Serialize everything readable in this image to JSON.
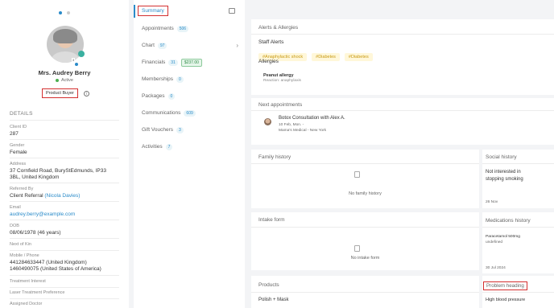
{
  "profile": {
    "name": "Mrs. Audrey Berry",
    "status": "Active",
    "tag": "Product Buyer",
    "avatar_badge": "3"
  },
  "details": {
    "heading": "DETAILS",
    "client_id_label": "Client ID",
    "client_id": "287",
    "gender_label": "Gender",
    "gender": "Female",
    "address_label": "Address",
    "address": "37 Cornfield Road, BuryStEdmunds, IP33 3BL, United Kingdom",
    "referred_label": "Referred By",
    "referred_prefix": "Client Referral",
    "referred_name": "(Nicola Davies)",
    "email_label": "Email",
    "email": "audrey.berry@example.com",
    "dob_label": "DOB",
    "dob": "08/06/1978 (46 years)",
    "kin_label": "Next of Kin",
    "mobile_label": "Mobile / Phone",
    "mobile1": "441284633447 (United Kingdom)",
    "mobile2": "1460490075 (United States of America)",
    "treat_interest_label": "Treatment Interest",
    "laser_label": "Laser Treatment Preference",
    "doctor_label": "Assigned Doctor"
  },
  "nav": {
    "summary": "Summary",
    "items": [
      {
        "label": "Appointments",
        "badge": "506"
      },
      {
        "label": "Chart",
        "badge": "97"
      },
      {
        "label": "Financials",
        "badge": "31",
        "badge2": "$237.00"
      },
      {
        "label": "Memberships",
        "badge": "0"
      },
      {
        "label": "Packages",
        "badge": "0"
      },
      {
        "label": "Communications",
        "badge": "609"
      },
      {
        "label": "Gift Vouchers",
        "badge": "3"
      },
      {
        "label": "Activities",
        "badge": "7"
      }
    ]
  },
  "alerts": {
    "title": "Alerts & Allergies",
    "staff_alerts": "Staff Alerts",
    "tags": [
      "#Anaphylactic shock",
      "#Diabetes",
      "#Diabetes"
    ],
    "allergies": "Allergies",
    "allergy_name": "Peanut allergy",
    "allergy_reaction": "Reaction: anaphylaxis"
  },
  "next_appointments": {
    "title": "Next appointments",
    "appt_title": "Botox Consultation with Alex A.",
    "appt_time": "10 Feb, Mon. -",
    "appt_location": "Mama's Medical - New York"
  },
  "family": {
    "title": "Family history",
    "empty": "No family history"
  },
  "intake": {
    "title": "Intake form",
    "empty": "No intake form"
  },
  "products": {
    "title": "Products",
    "item": "Polish + Mask"
  },
  "social": {
    "title": "Social history",
    "text": "Not interested in stopping smoking",
    "date": "26 Nov"
  },
  "medications": {
    "title": "Medications history",
    "name": "Paracetamol 500mg",
    "status": "undefined",
    "date": "30 Jul 2024"
  },
  "problem": {
    "title": "Problem heading",
    "item": "High blood pressure"
  }
}
